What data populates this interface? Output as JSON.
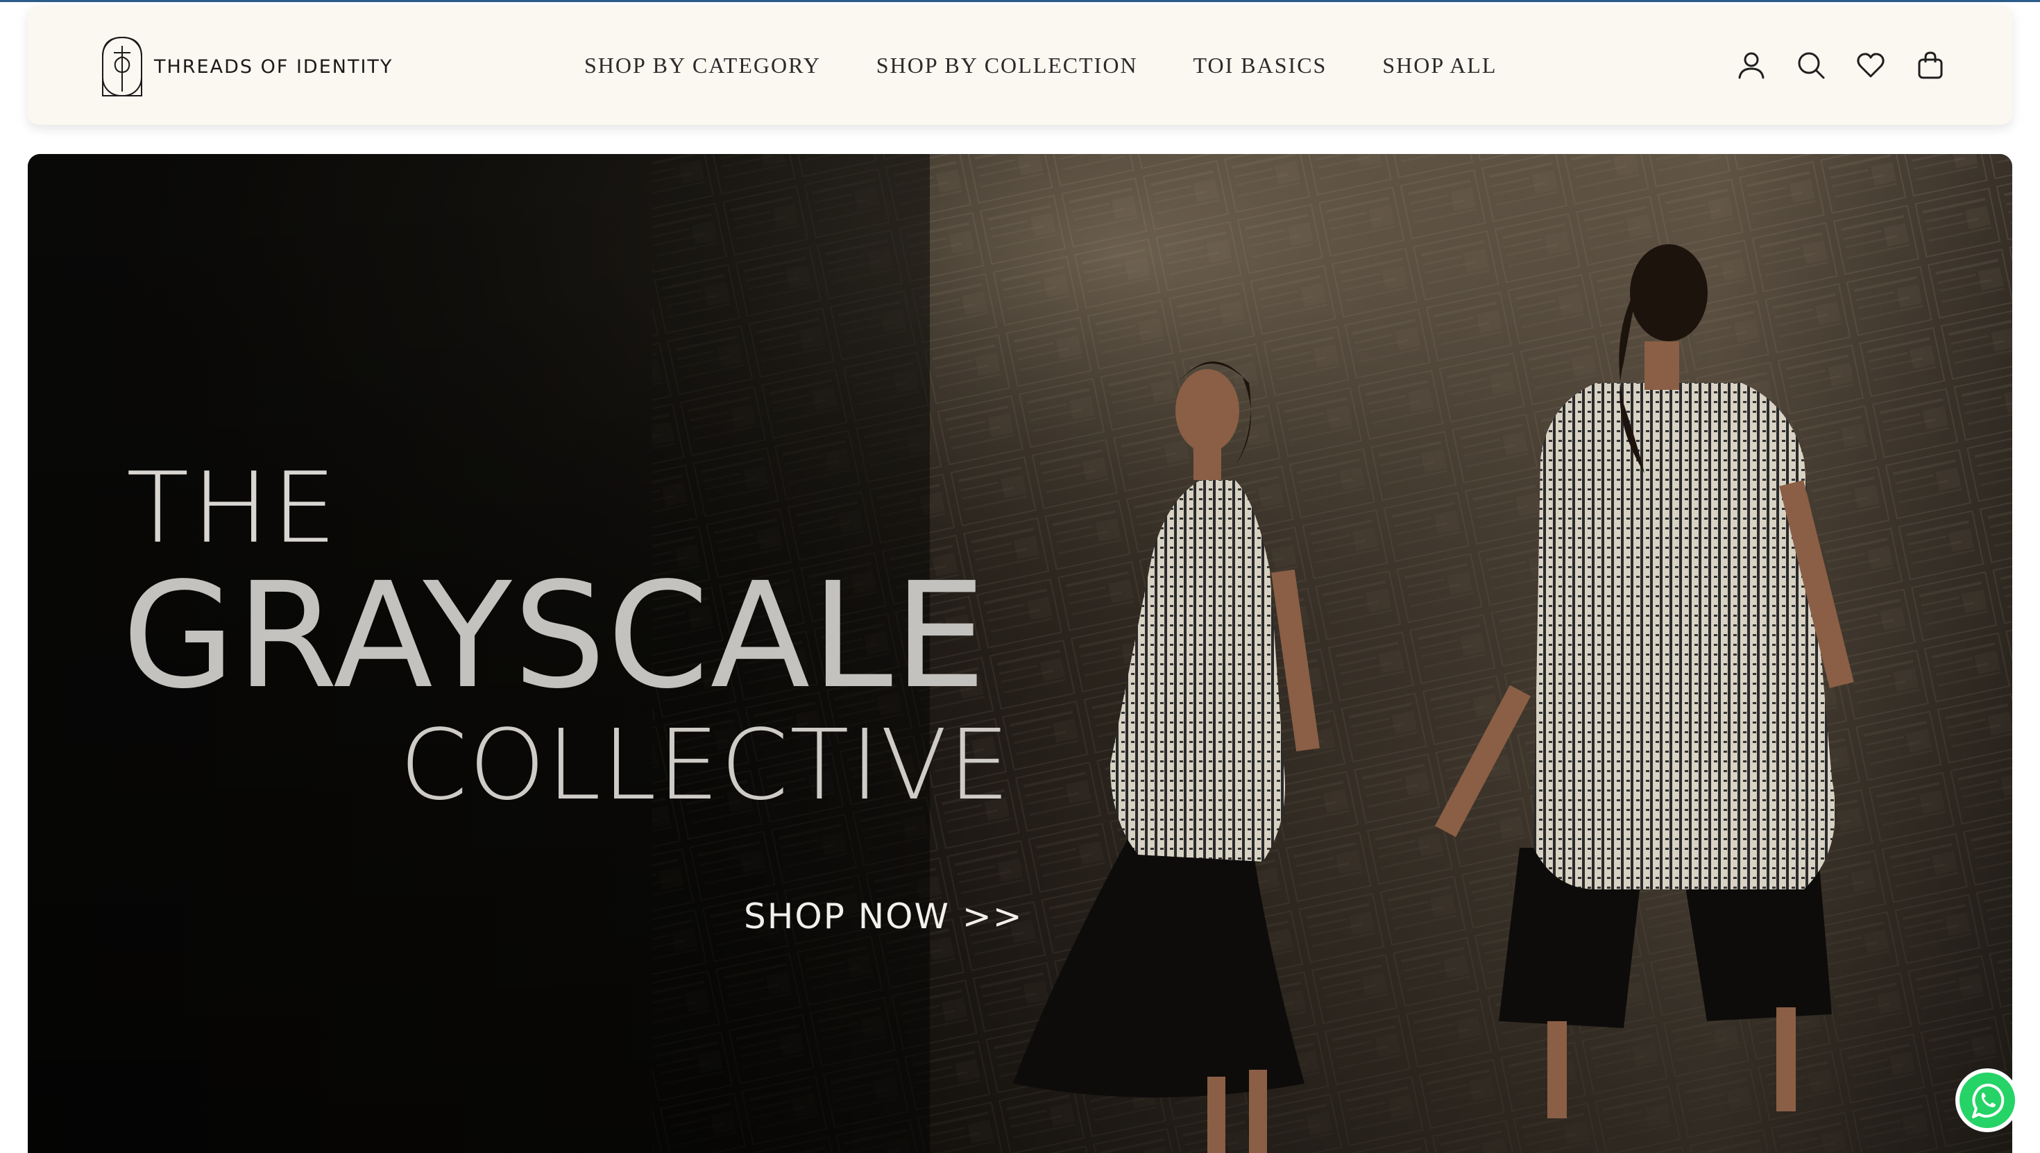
{
  "header": {
    "logo_text": "THREADS OF IDENTITY",
    "logo_icon": "toi-monogram-icon",
    "nav": [
      {
        "label": "SHOP BY CATEGORY"
      },
      {
        "label": "SHOP BY COLLECTION"
      },
      {
        "label": "TOI BASICS"
      },
      {
        "label": "SHOP ALL"
      }
    ],
    "icons": [
      "account-icon",
      "search-icon",
      "wishlist-heart-icon",
      "cart-bag-icon"
    ]
  },
  "hero": {
    "line1": "THE",
    "line2": "GRAYSCALE",
    "line3": "COLLECTIVE",
    "cta": "SHOP NOW >>",
    "image": "two-models-in-grayscale-kurtas-holding-hands-newspaper-backdrop"
  },
  "whatsapp": {
    "icon": "whatsapp-icon"
  },
  "colors": {
    "header_bg": "#fbf7f1",
    "top_accent": "#2c5d8a",
    "hero_dark": "#0d0b09",
    "whatsapp_green": "#25d366"
  }
}
